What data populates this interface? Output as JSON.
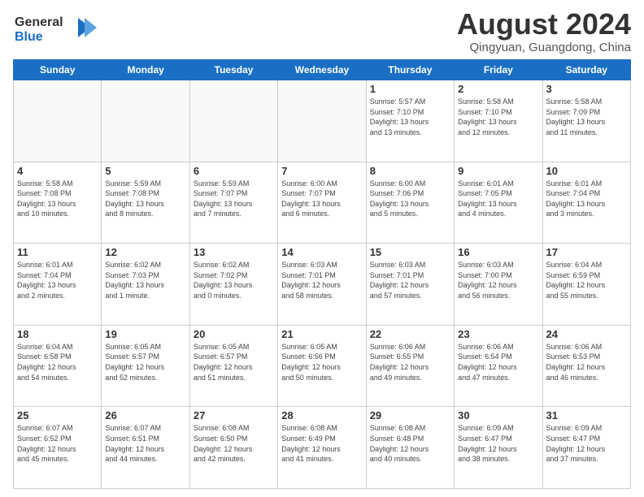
{
  "logo": {
    "line1": "General",
    "line2": "Blue"
  },
  "title": "August 2024",
  "location": "Qingyuan, Guangdong, China",
  "weekdays": [
    "Sunday",
    "Monday",
    "Tuesday",
    "Wednesday",
    "Thursday",
    "Friday",
    "Saturday"
  ],
  "weeks": [
    [
      {
        "day": "",
        "info": ""
      },
      {
        "day": "",
        "info": ""
      },
      {
        "day": "",
        "info": ""
      },
      {
        "day": "",
        "info": ""
      },
      {
        "day": "1",
        "info": "Sunrise: 5:57 AM\nSunset: 7:10 PM\nDaylight: 13 hours\nand 13 minutes."
      },
      {
        "day": "2",
        "info": "Sunrise: 5:58 AM\nSunset: 7:10 PM\nDaylight: 13 hours\nand 12 minutes."
      },
      {
        "day": "3",
        "info": "Sunrise: 5:58 AM\nSunset: 7:09 PM\nDaylight: 13 hours\nand 11 minutes."
      }
    ],
    [
      {
        "day": "4",
        "info": "Sunrise: 5:58 AM\nSunset: 7:08 PM\nDaylight: 13 hours\nand 10 minutes."
      },
      {
        "day": "5",
        "info": "Sunrise: 5:59 AM\nSunset: 7:08 PM\nDaylight: 13 hours\nand 8 minutes."
      },
      {
        "day": "6",
        "info": "Sunrise: 5:59 AM\nSunset: 7:07 PM\nDaylight: 13 hours\nand 7 minutes."
      },
      {
        "day": "7",
        "info": "Sunrise: 6:00 AM\nSunset: 7:07 PM\nDaylight: 13 hours\nand 6 minutes."
      },
      {
        "day": "8",
        "info": "Sunrise: 6:00 AM\nSunset: 7:06 PM\nDaylight: 13 hours\nand 5 minutes."
      },
      {
        "day": "9",
        "info": "Sunrise: 6:01 AM\nSunset: 7:05 PM\nDaylight: 13 hours\nand 4 minutes."
      },
      {
        "day": "10",
        "info": "Sunrise: 6:01 AM\nSunset: 7:04 PM\nDaylight: 13 hours\nand 3 minutes."
      }
    ],
    [
      {
        "day": "11",
        "info": "Sunrise: 6:01 AM\nSunset: 7:04 PM\nDaylight: 13 hours\nand 2 minutes."
      },
      {
        "day": "12",
        "info": "Sunrise: 6:02 AM\nSunset: 7:03 PM\nDaylight: 13 hours\nand 1 minute."
      },
      {
        "day": "13",
        "info": "Sunrise: 6:02 AM\nSunset: 7:02 PM\nDaylight: 13 hours\nand 0 minutes."
      },
      {
        "day": "14",
        "info": "Sunrise: 6:03 AM\nSunset: 7:01 PM\nDaylight: 12 hours\nand 58 minutes."
      },
      {
        "day": "15",
        "info": "Sunrise: 6:03 AM\nSunset: 7:01 PM\nDaylight: 12 hours\nand 57 minutes."
      },
      {
        "day": "16",
        "info": "Sunrise: 6:03 AM\nSunset: 7:00 PM\nDaylight: 12 hours\nand 56 minutes."
      },
      {
        "day": "17",
        "info": "Sunrise: 6:04 AM\nSunset: 6:59 PM\nDaylight: 12 hours\nand 55 minutes."
      }
    ],
    [
      {
        "day": "18",
        "info": "Sunrise: 6:04 AM\nSunset: 6:58 PM\nDaylight: 12 hours\nand 54 minutes."
      },
      {
        "day": "19",
        "info": "Sunrise: 6:05 AM\nSunset: 6:57 PM\nDaylight: 12 hours\nand 52 minutes."
      },
      {
        "day": "20",
        "info": "Sunrise: 6:05 AM\nSunset: 6:57 PM\nDaylight: 12 hours\nand 51 minutes."
      },
      {
        "day": "21",
        "info": "Sunrise: 6:05 AM\nSunset: 6:56 PM\nDaylight: 12 hours\nand 50 minutes."
      },
      {
        "day": "22",
        "info": "Sunrise: 6:06 AM\nSunset: 6:55 PM\nDaylight: 12 hours\nand 49 minutes."
      },
      {
        "day": "23",
        "info": "Sunrise: 6:06 AM\nSunset: 6:54 PM\nDaylight: 12 hours\nand 47 minutes."
      },
      {
        "day": "24",
        "info": "Sunrise: 6:06 AM\nSunset: 6:53 PM\nDaylight: 12 hours\nand 46 minutes."
      }
    ],
    [
      {
        "day": "25",
        "info": "Sunrise: 6:07 AM\nSunset: 6:52 PM\nDaylight: 12 hours\nand 45 minutes."
      },
      {
        "day": "26",
        "info": "Sunrise: 6:07 AM\nSunset: 6:51 PM\nDaylight: 12 hours\nand 44 minutes."
      },
      {
        "day": "27",
        "info": "Sunrise: 6:08 AM\nSunset: 6:50 PM\nDaylight: 12 hours\nand 42 minutes."
      },
      {
        "day": "28",
        "info": "Sunrise: 6:08 AM\nSunset: 6:49 PM\nDaylight: 12 hours\nand 41 minutes."
      },
      {
        "day": "29",
        "info": "Sunrise: 6:08 AM\nSunset: 6:48 PM\nDaylight: 12 hours\nand 40 minutes."
      },
      {
        "day": "30",
        "info": "Sunrise: 6:09 AM\nSunset: 6:47 PM\nDaylight: 12 hours\nand 38 minutes."
      },
      {
        "day": "31",
        "info": "Sunrise: 6:09 AM\nSunset: 6:47 PM\nDaylight: 12 hours\nand 37 minutes."
      }
    ]
  ]
}
